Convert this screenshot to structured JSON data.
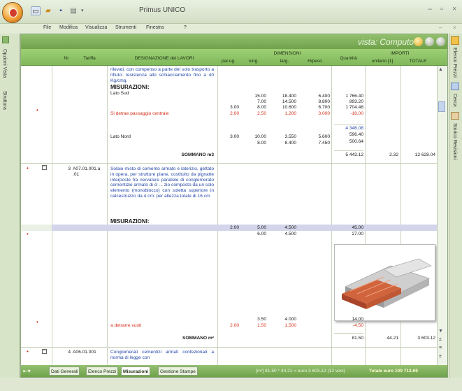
{
  "app": {
    "title": "Primus UNICO"
  },
  "menu": [
    "File",
    "Modifica",
    "Visualizza",
    "Strumenti",
    "Finestra",
    "?"
  ],
  "left_tabs": [
    "Opzioni Vista",
    "Struttura"
  ],
  "right_tabs": [
    "Elenco Prezzi",
    "Cerca",
    "Storico Revisioni"
  ],
  "vista": {
    "label": "vista: Computo"
  },
  "header": {
    "nr": "Nr",
    "tariffa": "Tariffa",
    "designazione": "DESIGNAZIONE dei LAVORI",
    "parug": "par.ug.",
    "dimensioni": "DIMENSIONI",
    "lung": "lung.",
    "larg": "larg.",
    "hpeso": "H/peso",
    "quantita": "Quantità",
    "importi": "IMPORTI",
    "unitario": "unitario [1]",
    "totale": "TOTALE"
  },
  "rows": {
    "r1_desc": "rilevati, con compenso a parte del solo trasporto a rifiuto: resistenza allo schiacciamento fino a 40 Kg/cmq.",
    "r1_mis": "MISURAZIONI:",
    "r1_lato_sud": "Lato Sud",
    "r1_sud_lines": [
      {
        "lung": "15.00",
        "larg": "18.400",
        "h": "6.400",
        "q": "1 766.40"
      },
      {
        "lung": "7.00",
        "larg": "14.500",
        "h": "8.800",
        "q": "893.20"
      },
      {
        "par": "3.00",
        "lung": "8.00",
        "larg": "10.600",
        "h": "6.700",
        "q": "1 704.48"
      }
    ],
    "r1_detrae": "Si detrae passaggio centrale",
    "r1_detrae_vals": {
      "par": "2.00",
      "lung": "2.50",
      "larg": "1.200",
      "h": "3.000",
      "q": "-18.00"
    },
    "r1_subtot": "4 346.08",
    "r1_lato_nord": "Lato Nord",
    "r1_nord_lines": [
      {
        "par": "3.00",
        "lung": "10.00",
        "larg": "3.550",
        "h": "5.600",
        "q": "596.40"
      },
      {
        "lung": "8.00",
        "larg": "8.400",
        "h": "7.450",
        "q": "500.64"
      }
    ],
    "r1_sommano": "SOMMANO m3",
    "r1_qtot": "5 443.12",
    "r1_unit": "2.32",
    "r1_tot": "12 628.04",
    "r2_nr": "3",
    "r2_tar": "A07.01.001.a .01",
    "r2_desc": "Solaio misto di cemento armato e laterizio, gettato in opera, per strutture piane, costituito da pignatte interposte fra nervature parallele di conglomerato cementizio armato di cl ... zio composto da un solo elemento (monoblocco) con soletta superiore in calcestruzzo da 4 cm: per altezza totale di 16 cm",
    "r2_mis": "MISURAZIONI:",
    "r2_lines": [
      {
        "par": "2.00",
        "lung": "5.00",
        "larg": "4.500",
        "q": "45.00"
      },
      {
        "lung": "6.00",
        "larg": "4.500",
        "q": "27.00"
      }
    ],
    "r2_line3": {
      "lung": "3.50",
      "larg": "4.000",
      "q": "14.00"
    },
    "r2_detrarre": "a detrarre vuoti",
    "r2_detrarre_vals": {
      "par": "2.00",
      "lung": "1.50",
      "larg": "1.500",
      "q": "-4.50"
    },
    "r2_sommano": "SOMMANO m²",
    "r2_qtot": "81.50",
    "r2_unit": "44.21",
    "r2_tot": "3 603.12",
    "r3_nr": "4",
    "r3_tar": "A06.01.001",
    "r3_desc": "Conglomerati cementizi armati confezionati a norma di legge con"
  },
  "bottom_tabs": [
    "Dati Generali",
    "Elenco Prezzi",
    "Misurazioni",
    "Gestione Stampe"
  ],
  "active_tab": "Misurazioni",
  "status": {
    "formula": "[m²] 81.50 * 44.21 = euro 3 603.12  (12 voci)",
    "totale": "Totale euro 109 713.69"
  }
}
